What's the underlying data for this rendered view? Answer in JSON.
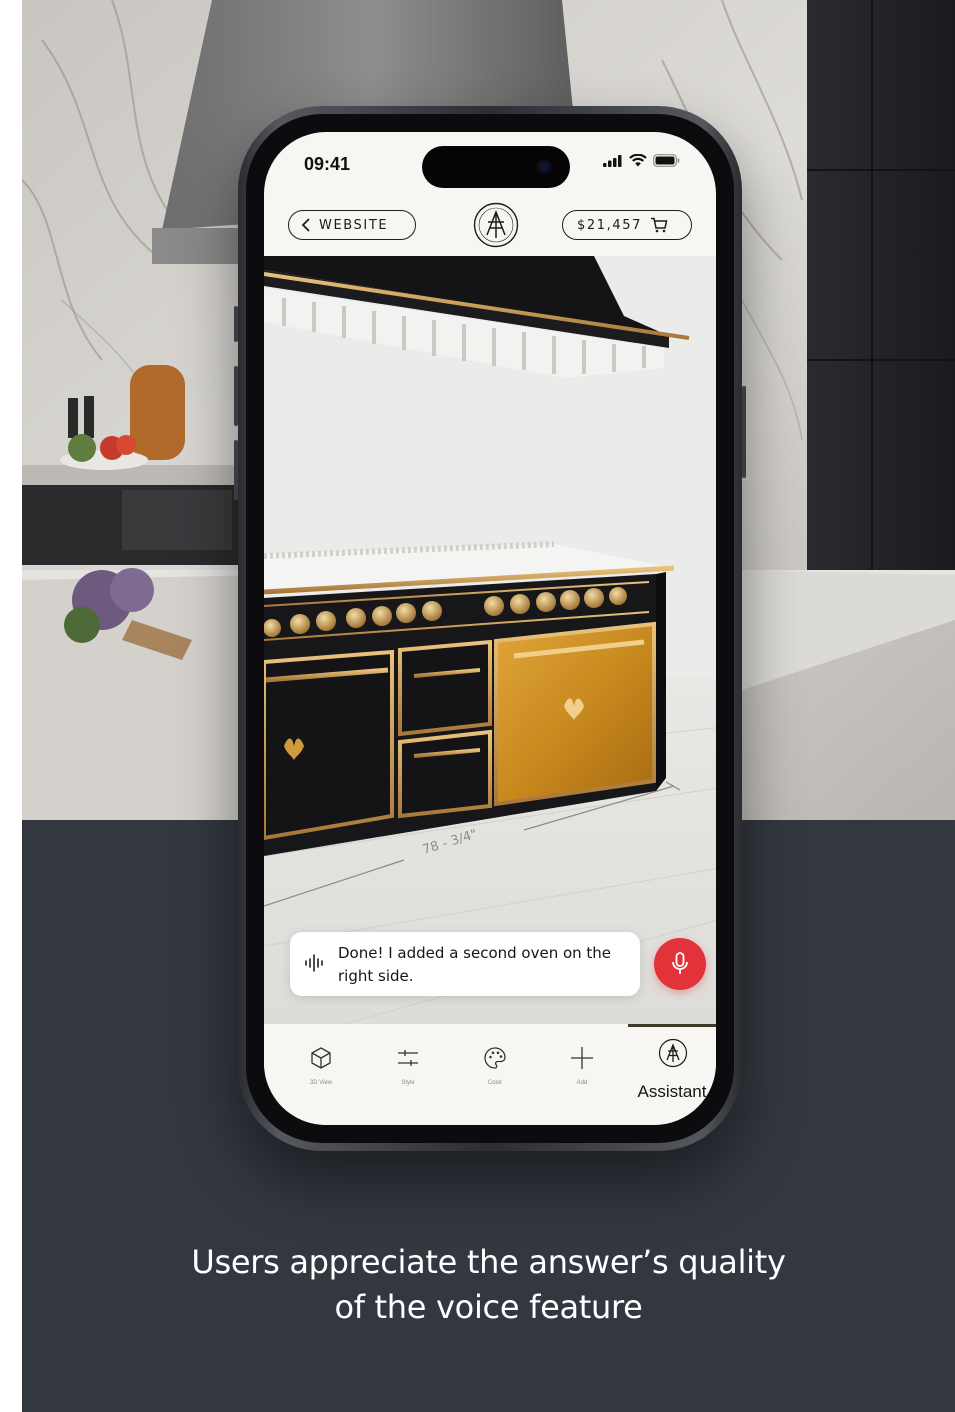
{
  "status_bar": {
    "time": "09:41"
  },
  "header": {
    "back_label": "WEBSITE",
    "cart_total": "$21,457",
    "logo_icon": "brand-monogram-icon"
  },
  "configurator": {
    "dimension_label": "78 - 3/4\""
  },
  "assistant": {
    "message": "Done! I added a second oven on the right side.",
    "mic_color": "#e3333a"
  },
  "tabs": [
    {
      "label": "3D View",
      "icon": "cube-icon"
    },
    {
      "label": "Style",
      "icon": "sliders-icon"
    },
    {
      "label": "Color",
      "icon": "palette-icon"
    },
    {
      "label": "Add",
      "icon": "plus-icon"
    },
    {
      "label": "Assistant",
      "icon": "brand-monogram-icon",
      "active": true
    }
  ],
  "caption": {
    "line1": "Users appreciate the answer’s quality",
    "line2": "of the voice feature"
  },
  "colors": {
    "accent_gold": "#c9932a",
    "range_black": "#16161a",
    "background": "#33373f"
  }
}
